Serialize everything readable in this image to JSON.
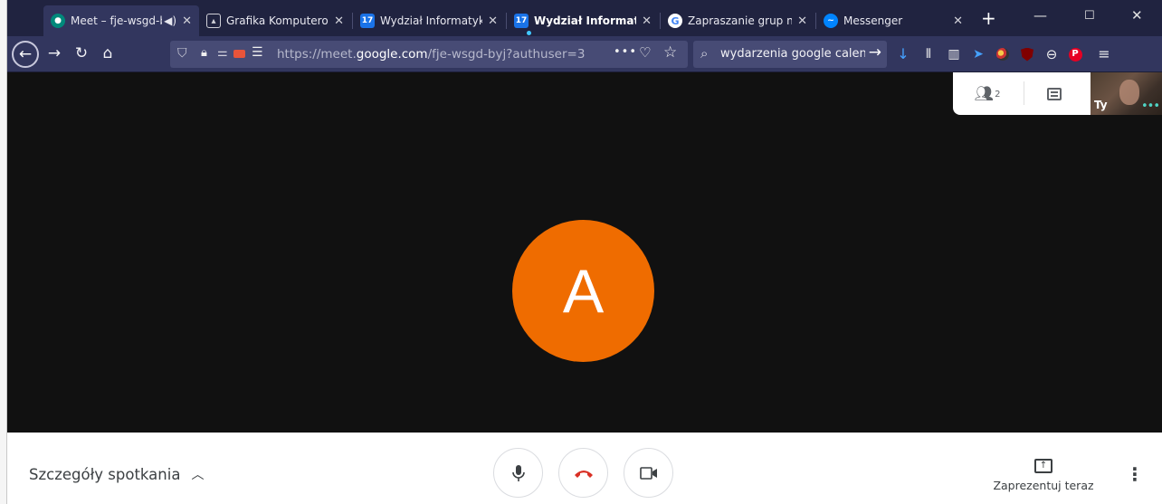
{
  "browser": {
    "tabs": [
      {
        "label": "Meet – fje-wsgd-b",
        "active": true,
        "audio_icon": "speaker-icon",
        "favicon": "meet-icon"
      },
      {
        "label": "Grafika Komputerowa",
        "favicon": "classroom-icon"
      },
      {
        "label": "Wydział Informatyki, ",
        "favicon": "calendar-icon"
      },
      {
        "label": "Wydział Informatyki",
        "bold": true,
        "favicon": "calendar-icon"
      },
      {
        "label": "Zapraszanie grup na ",
        "favicon": "google-icon"
      },
      {
        "label": "Messenger",
        "favicon": "messenger-icon"
      }
    ],
    "calendar_day": "17",
    "new_tab_symbol": "+",
    "window_controls": [
      "—",
      "☐",
      "✕"
    ],
    "url": {
      "prefix": "https://meet.",
      "domain": "google.com",
      "suffix": "/fje-wsgd-byj?authuser=3"
    },
    "url_more": "•••",
    "search": {
      "value": "wydarzenia google calendar"
    }
  },
  "meet": {
    "avatar_letter": "A",
    "participants_count": "2",
    "self_label": "Ty",
    "details_label": "Szczegóły spotkania",
    "present_label": "Zaprezentuj teraz"
  },
  "colors": {
    "avatar": "#ef6c00",
    "end_call": "#d93025",
    "tabbar": "#202340",
    "navbar": "#32365e"
  }
}
